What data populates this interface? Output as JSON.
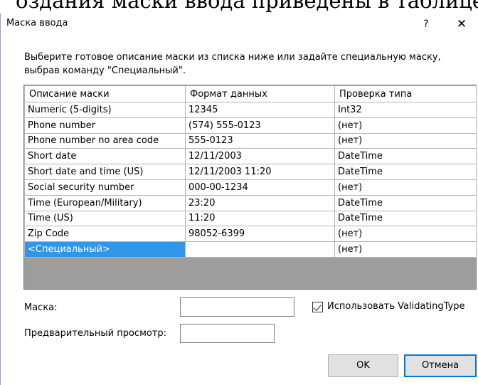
{
  "page_header": "оздания маски ввода приведены в таблице",
  "dialog": {
    "title": "Маска ввода",
    "help_label": "?",
    "close_label": "✕"
  },
  "instructions": "Выберите готовое описание маски из списка ниже или задайте специальную маску, выбрав команду \"Специальный\".",
  "grid": {
    "columns": [
      "Описание маски",
      "Формат данных",
      "Проверка типа"
    ],
    "rows": [
      [
        "Numeric (5-digits)",
        "12345",
        "Int32"
      ],
      [
        "Phone number",
        "(574) 555-0123",
        "(нет)"
      ],
      [
        "Phone number no area code",
        "555-0123",
        "(нет)"
      ],
      [
        "Short date",
        "12/11/2003",
        "DateTime"
      ],
      [
        "Short date and time (US)",
        "12/11/2003 11:20",
        "DateTime"
      ],
      [
        "Social security number",
        "000-00-1234",
        "(нет)"
      ],
      [
        "Time (European/Military)",
        "23:20",
        "DateTime"
      ],
      [
        "Time (US)",
        "11:20",
        "DateTime"
      ],
      [
        "Zip Code",
        "98052-6399",
        "(нет)"
      ],
      [
        "<Специальный>",
        "",
        "(нет)"
      ]
    ],
    "selected_row": 9
  },
  "mask_label": "Маска:",
  "mask_value": "",
  "preview_label": "Предварительный просмотр:",
  "preview_value": "",
  "validating_label": "Использовать ValidatingType",
  "validating_checked": true,
  "ok_label": "OK",
  "cancel_label": "Отмена",
  "icons": {
    "close": "close-icon",
    "help": "help-icon",
    "check": "checkmark-icon"
  }
}
